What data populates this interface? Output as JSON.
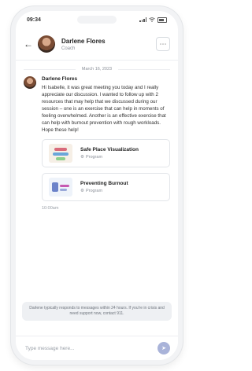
{
  "status_bar": {
    "time": "09:34"
  },
  "header": {
    "back_icon": "←",
    "name": "Darlene Flores",
    "role": "Coach",
    "more_icon": "⋯"
  },
  "chat": {
    "date": "March 16, 2023",
    "message": {
      "sender": "Darlene Flores",
      "text": "Hi Isabelle, it was great meeting you today and I really appreciate our discussion. I wanted to follow up with 2 resources that may help that we discussed during our session – one is an exercise that can help in moments of feeling overwhelmed. Another is an effective exercise that can help with burnout prevention with rough workloads. Hope these help!",
      "time": "10:00am",
      "cards": [
        {
          "title": "Safe Place Visualization",
          "type": "Program",
          "icon": "program-icon"
        },
        {
          "title": "Preventing Burnout",
          "type": "Program",
          "icon": "program-icon"
        }
      ]
    }
  },
  "notice": {
    "text": "Darlene typically responds to messages within 24 hours. If you're in crisis and need support now, contact 911."
  },
  "composer": {
    "placeholder": "Type message here...",
    "send_icon": "➤"
  }
}
